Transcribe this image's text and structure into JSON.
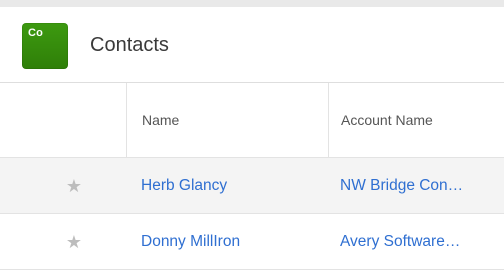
{
  "module": {
    "icon_abbr": "Co",
    "title": "Contacts",
    "icon_color": "#38900d"
  },
  "table": {
    "columns": [
      "Name",
      "Account Name"
    ],
    "rows": [
      {
        "name": "Herb Glancy",
        "account": "NW Bridge Con…",
        "favorite_icon": "star-icon"
      },
      {
        "name": "Donny MillIron",
        "account": "Avery Software…",
        "favorite_icon": "star-icon"
      }
    ]
  },
  "colors": {
    "link": "#2f6fd1",
    "row_shade": "#f4f4f4",
    "star": "#bdbdbd"
  }
}
